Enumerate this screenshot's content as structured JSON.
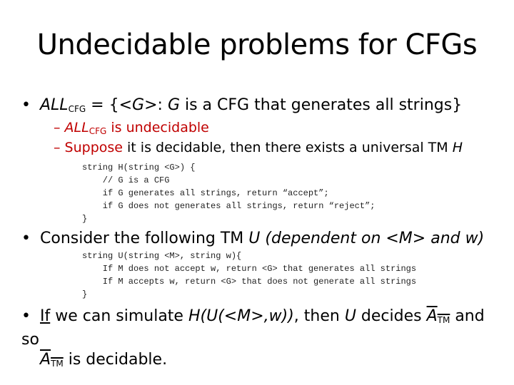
{
  "slide": {
    "title": "Undecidable problems for CFGs",
    "bullet1": {
      "lang": "ALL",
      "lang_sub": "CFG",
      "rest": " = {<G>: G is a CFG that generates all strings}",
      "rest_pre": " = {<",
      "rest_G": "G",
      "rest_mid": ">: ",
      "rest_G2": "G",
      "rest_end": " is a CFG that generates all strings}"
    },
    "sub1": {
      "dash": "–",
      "lang": "ALL",
      "lang_sub": "CFG",
      "text": " is undecidable"
    },
    "sub2": {
      "dash": "–",
      "highlight": "Suppose",
      "text": " it is decidable, then there exists a universal TM ",
      "tm": "H"
    },
    "code1": [
      "string H(string <G>) {",
      "    // G is a CFG",
      "    if G generates all strings, return “accept”;",
      "    if G does not generates all strings, return “reject”;",
      "}"
    ],
    "bullet2": {
      "text": "Consider the following TM ",
      "italic": "U (dependent on <M> and w)"
    },
    "code2": [
      "string U(string <M>, string w){",
      "    If M does not accept w, return <G> that generates all strings",
      "    If M accepts w, return <G> that does not generate all strings",
      "}"
    ],
    "bullet3": {
      "if": "If",
      "t1": " we can simulate ",
      "h_expr": "H(U(<M>,w))",
      "t2": ", then ",
      "u": "U",
      "t3": " decides ",
      "a": "A",
      "a_sub": "TM",
      "t4": " and so",
      "t5": " is decidable."
    },
    "colors": {
      "accent_red": "#c00000",
      "text": "#000000"
    }
  }
}
